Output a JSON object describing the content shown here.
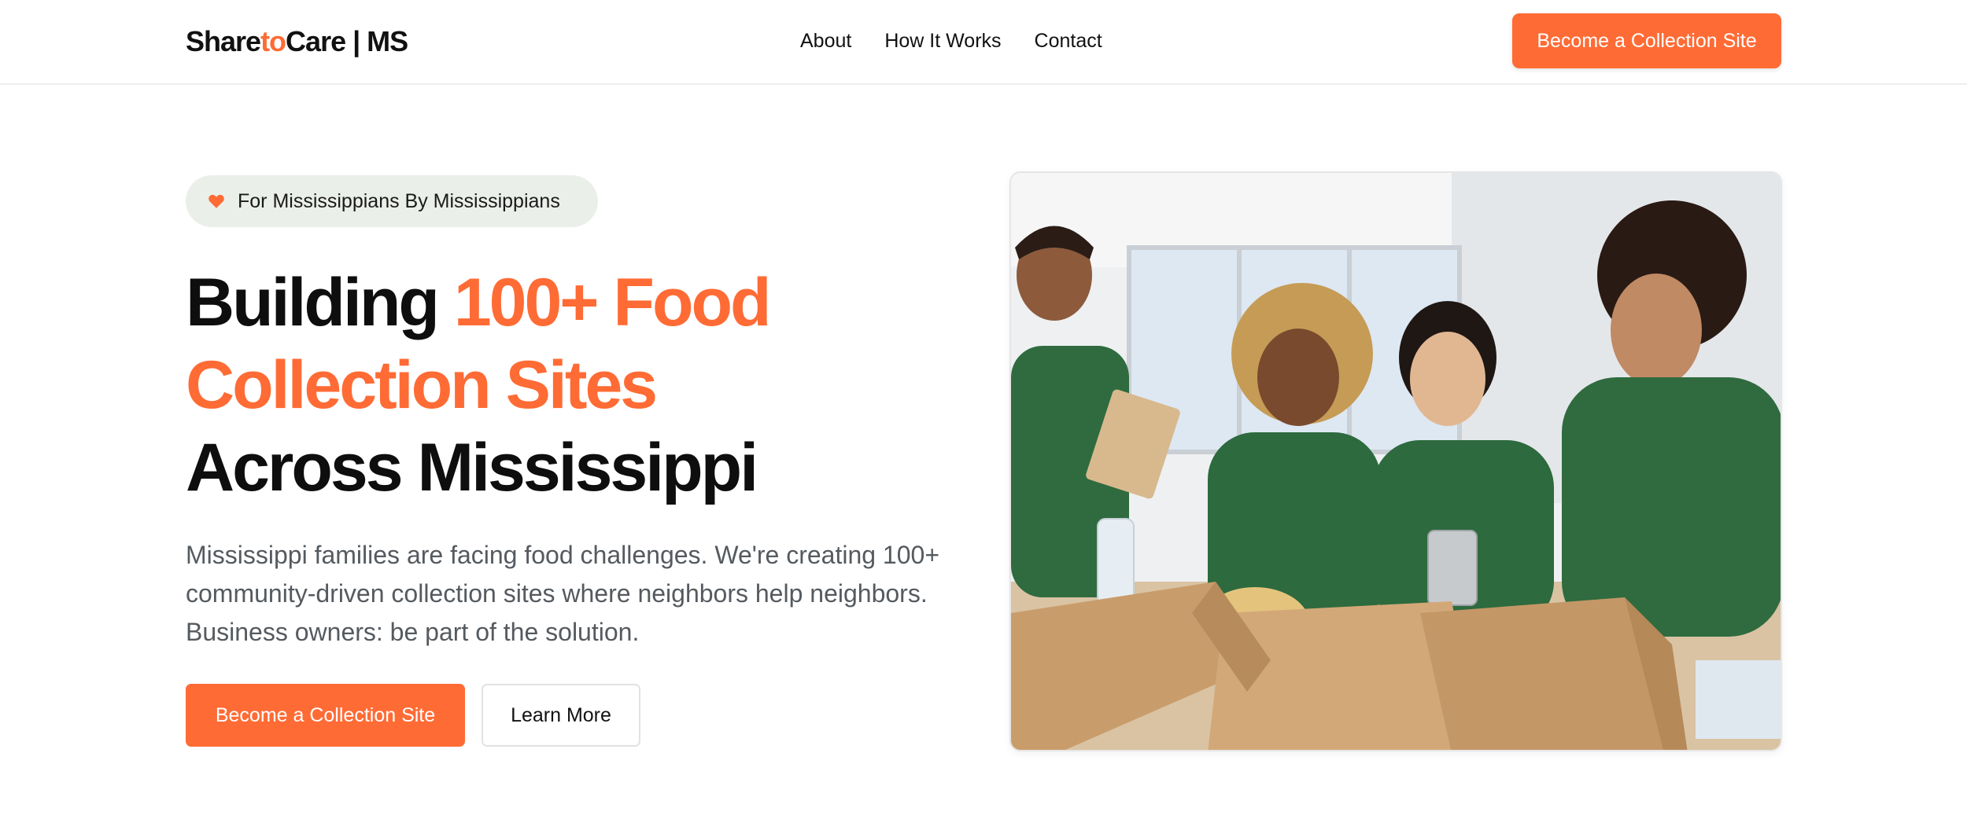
{
  "header": {
    "logo": {
      "part1": "Share",
      "part2": "to",
      "part3": "Care | MS"
    },
    "nav": [
      {
        "label": "About"
      },
      {
        "label": "How It Works"
      },
      {
        "label": "Contact"
      }
    ],
    "cta_label": "Become a Collection Site"
  },
  "hero": {
    "badge_text": "For Mississippians By Mississippians",
    "badge_icon": "heart-icon",
    "title": {
      "part1": "Building ",
      "highlight": "100+ Food Collection Sites",
      "part2": " Across Mississippi"
    },
    "description": "Mississippi families are facing food challenges. We're creating 100+ community-driven collection sites where neighbors help neighbors. Business owners: be part of the solution.",
    "primary_button": "Become a Collection Site",
    "secondary_button": "Learn More",
    "image_icon": "volunteers-photo"
  },
  "colors": {
    "accent": "#ff6b35",
    "badge_bg": "#ebefe9",
    "text_dark": "#0e0e0e",
    "text_muted": "#555a5f"
  }
}
